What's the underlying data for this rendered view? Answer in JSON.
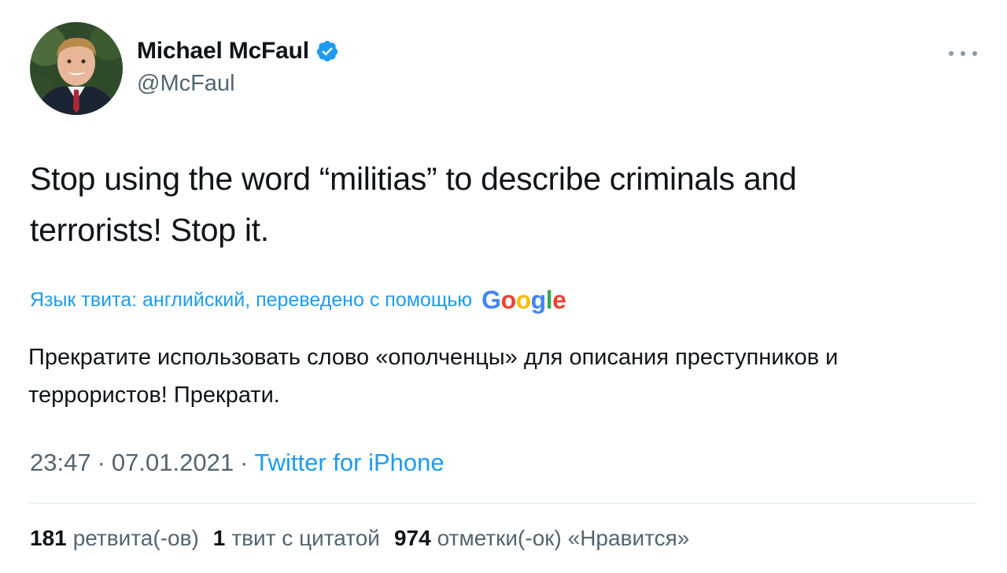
{
  "author": {
    "display_name": "Michael McFaul",
    "handle": "@McFaul",
    "avatar": "profile-photo",
    "verified_icon": "verified-badge-icon"
  },
  "tweet": {
    "text_line1": "Stop using the word “militias” to describe criminals and",
    "text_line2": "terrorists! Stop it."
  },
  "translation": {
    "label": "Язык твита: английский, переведено с помощью",
    "provider": "Google",
    "text_line1": "Прекратите использовать слово «ополченцы» для описания преступников и",
    "text_line2": "террористов! Прекрати."
  },
  "meta": {
    "time": "23:47",
    "separator": "·",
    "date": "07.01.2021",
    "source": "Twitter for iPhone"
  },
  "stats": {
    "retweets_count": "181",
    "retweets_label": "ретвита(-ов)",
    "quotes_count": "1",
    "quotes_label": "твит с цитатой",
    "likes_count": "974",
    "likes_label": "отметки(-ок) «Нравится»"
  },
  "colors": {
    "accent": "#1d9bf0",
    "text": "#0f1419",
    "secondary": "#536471"
  },
  "icons": {
    "more": "more-dots-icon"
  }
}
